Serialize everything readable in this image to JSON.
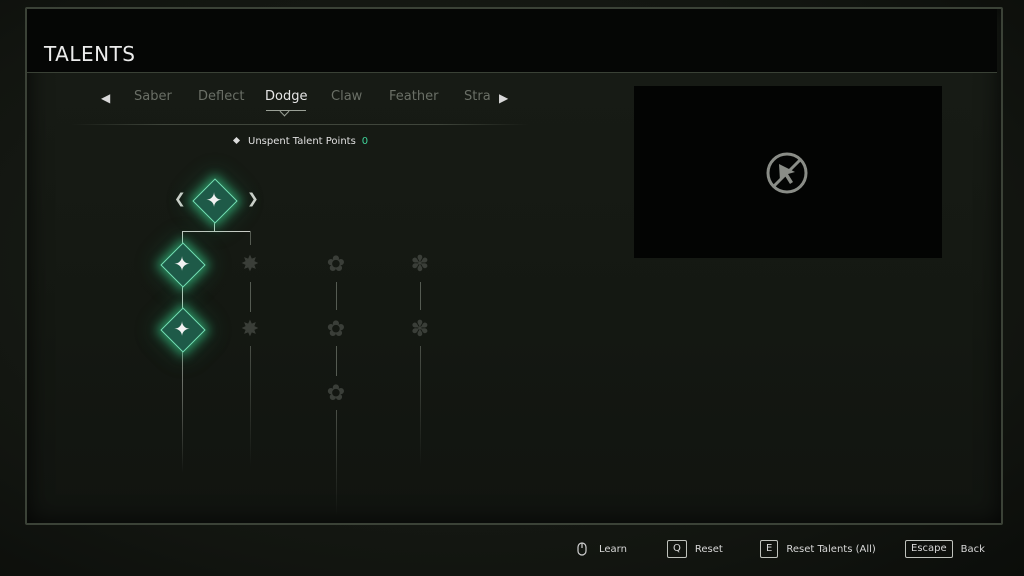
{
  "title": "TALENTS",
  "tabs": [
    {
      "label": "Saber",
      "active": false
    },
    {
      "label": "Deflect",
      "active": false
    },
    {
      "label": "Dodge",
      "active": true
    },
    {
      "label": "Claw",
      "active": false
    },
    {
      "label": "Feather",
      "active": false
    },
    {
      "label": "Stra",
      "active": false
    }
  ],
  "talent_points": {
    "label": "Unspent Talent Points",
    "value": "0"
  },
  "nodes": [
    {
      "id": "root",
      "state": "unlocked",
      "icon": "wolf-dodge-icon"
    },
    {
      "id": "col1-row1",
      "state": "unlocked",
      "icon": "wolf-dodge-icon"
    },
    {
      "id": "col1-row2",
      "state": "unlocked",
      "icon": "wolf-dodge-icon"
    },
    {
      "id": "col2-row1",
      "state": "locked",
      "icon": "wolf-slash-icon"
    },
    {
      "id": "col2-row2",
      "state": "locked",
      "icon": "wolf-slash-icon"
    },
    {
      "id": "col3-row1",
      "state": "locked",
      "icon": "beast-icon"
    },
    {
      "id": "col3-row2",
      "state": "locked",
      "icon": "beast-icon"
    },
    {
      "id": "col3-row3",
      "state": "locked",
      "icon": "beast-icon"
    },
    {
      "id": "col4-row1",
      "state": "locked",
      "icon": "raven-icon"
    },
    {
      "id": "col4-row2",
      "state": "locked",
      "icon": "raven-icon"
    }
  ],
  "preview": {
    "icon": "no-cursor-icon"
  },
  "footer": {
    "learn": {
      "key_icon": "mouse-icon",
      "label": "Learn"
    },
    "reset": {
      "key": "Q",
      "label": "Reset"
    },
    "reset_all": {
      "key": "E",
      "label": "Reset Talents (All)"
    },
    "back": {
      "key": "Escape",
      "label": "Back"
    }
  },
  "colors": {
    "accent": "#3fd39a",
    "glow": "#1e5a48"
  }
}
